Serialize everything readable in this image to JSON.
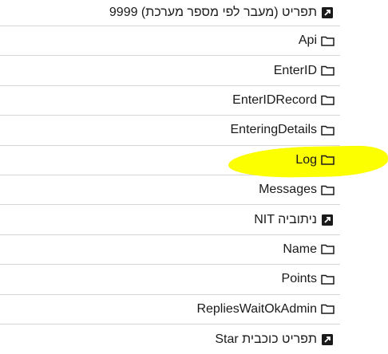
{
  "highlight_color": "#fbff00",
  "items": [
    {
      "label": "9999 (מעבר לפי מספר מערכת) תפריט",
      "icon": "external-link-icon"
    },
    {
      "label": "Api",
      "icon": "folder-icon"
    },
    {
      "label": "EnterID",
      "icon": "folder-icon"
    },
    {
      "label": "EnterIDRecord",
      "icon": "folder-icon"
    },
    {
      "label": "EnteringDetails",
      "icon": "folder-icon"
    },
    {
      "label": "Log",
      "icon": "folder-icon",
      "highlighted": true
    },
    {
      "label": "Messages",
      "icon": "folder-icon"
    },
    {
      "label": "NIT ניתוביה",
      "icon": "external-link-icon"
    },
    {
      "label": "Name",
      "icon": "folder-icon"
    },
    {
      "label": "Points",
      "icon": "folder-icon"
    },
    {
      "label": "RepliesWaitOkAdmin",
      "icon": "folder-icon"
    },
    {
      "label": "Star תפריט כוכבית",
      "icon": "external-link-icon"
    }
  ]
}
